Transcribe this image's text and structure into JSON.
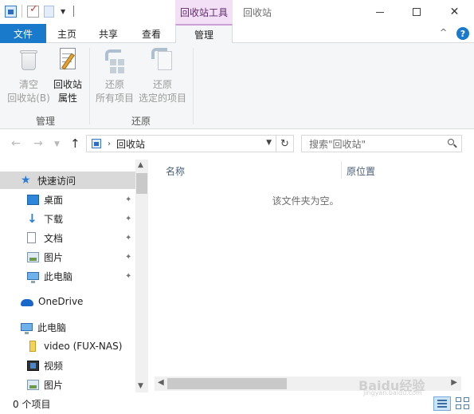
{
  "window": {
    "title": "回收站",
    "contextual_tab_group": "回收站工具",
    "minimize_label": "—",
    "maximize_label": "□",
    "close_label": "✕"
  },
  "ribbon_tabs": {
    "file": "文件",
    "home": "主页",
    "share": "共享",
    "view": "查看",
    "manage": "管理",
    "active": "manage"
  },
  "ribbon": {
    "buttons": [
      {
        "line1": "清空",
        "line2": "回收站(B)",
        "icon": "empty-recycle-bin-icon",
        "enabled": false
      },
      {
        "line1": "回收站",
        "line2": "属性",
        "icon": "recycle-bin-properties-icon",
        "enabled": true
      },
      {
        "line1": "还原",
        "line2": "所有项目",
        "icon": "restore-all-icon",
        "enabled": false
      },
      {
        "line1": "还原",
        "line2": "选定的项目",
        "icon": "restore-selected-icon",
        "enabled": false
      }
    ],
    "groups": [
      "管理",
      "还原"
    ]
  },
  "address": {
    "path": "回收站",
    "search_placeholder": "搜索\"回收站\""
  },
  "nav_pane": {
    "quick_access": "快速访问",
    "pinned": [
      "桌面",
      "下载",
      "文档",
      "图片",
      "此电脑"
    ],
    "onedrive": "OneDrive",
    "this_pc": "此电脑",
    "pc_items": [
      "video (FUX-NAS)",
      "视频",
      "图片"
    ]
  },
  "file_list": {
    "columns": [
      "名称",
      "原位置"
    ],
    "empty_message": "该文件夹为空。"
  },
  "status": {
    "item_count": "0 个项目"
  },
  "watermark": {
    "text": "Baidu经验",
    "sub": "jingyan.baidu.com"
  },
  "colors": {
    "file_tab": "#1979ca",
    "contextual_tab": "#f3e0f7",
    "selection": "#d9d9d9",
    "ribbon_bg": "#f5f6f7"
  }
}
